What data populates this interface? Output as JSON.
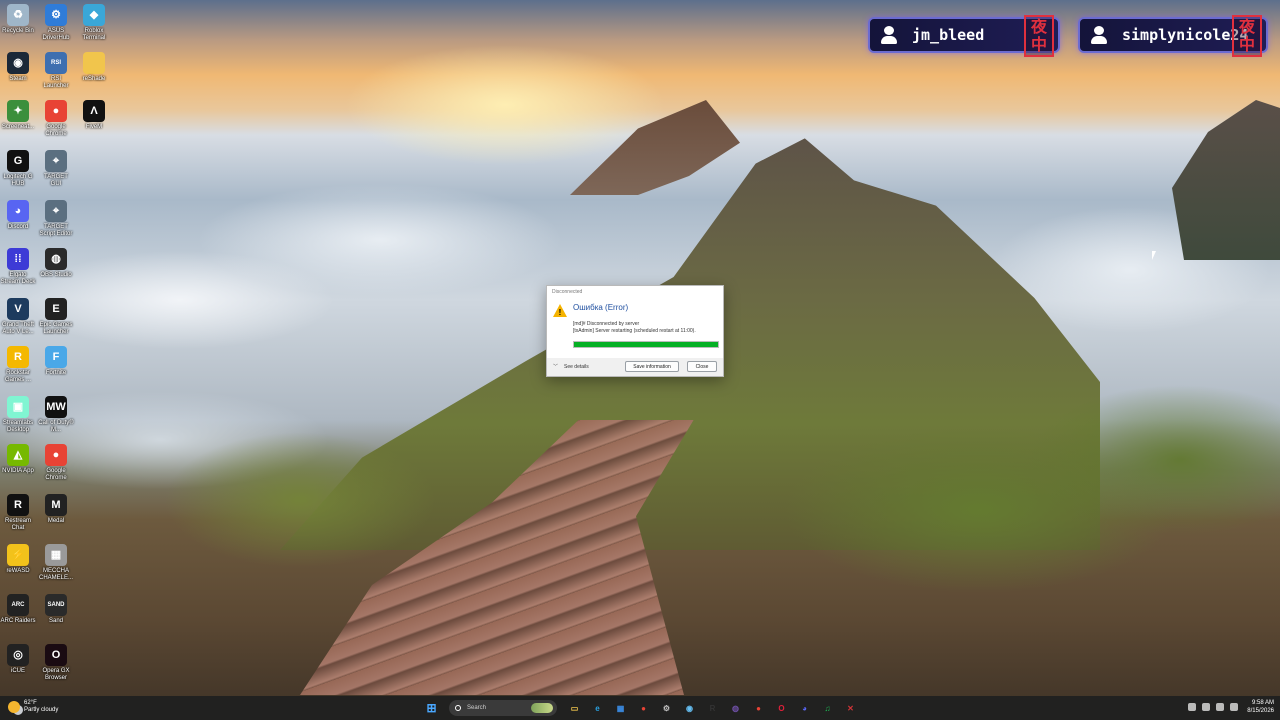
{
  "desktop_icons": [
    {
      "label": "Recycle Bin",
      "icon": "recycle-bin-icon",
      "color": "#9fb6c9",
      "glyph": "♻"
    },
    {
      "label": "ASUS DriverHub",
      "icon": "asus-icon",
      "color": "#2f7cd8",
      "glyph": "⚙"
    },
    {
      "label": "Roblox Terminal",
      "icon": "roblox-icon",
      "color": "#3aa7d8",
      "glyph": "◆"
    },
    {
      "label": "Steam",
      "icon": "steam-icon",
      "color": "#1b2838",
      "glyph": "◉"
    },
    {
      "label": "RSI Launcher",
      "icon": "rsi-icon",
      "color": "#3e6fb0",
      "glyph": "RSI"
    },
    {
      "label": "reShade",
      "icon": "folder-icon",
      "color": "#f1c54c",
      "glyph": ""
    },
    {
      "label": "Screeneat...",
      "icon": "app-icon",
      "color": "#3c8f3c",
      "glyph": "✦"
    },
    {
      "label": "Google Chrome",
      "icon": "chrome-icon",
      "color": "#e84335",
      "glyph": "●"
    },
    {
      "label": "FiveM",
      "icon": "fivem-icon",
      "color": "#111111",
      "glyph": "Λ"
    },
    {
      "label": "Logitech G HUB",
      "icon": "logitech-icon",
      "color": "#111111",
      "glyph": "G"
    },
    {
      "label": "TARGET GUI",
      "icon": "target-icon",
      "color": "#5b6f80",
      "glyph": "⌖"
    },
    {
      "label": "Discord",
      "icon": "discord-icon",
      "color": "#5865f2",
      "glyph": "◕"
    },
    {
      "label": "TARGET Script Editor",
      "icon": "target-script-icon",
      "color": "#5b6f80",
      "glyph": "⌖"
    },
    {
      "label": "Elgato Stream Deck",
      "icon": "streamdeck-icon",
      "color": "#3d3bd6",
      "glyph": "⁞⁞"
    },
    {
      "label": "OBS Studio",
      "icon": "obs-icon",
      "color": "#2b2b2b",
      "glyph": "◍"
    },
    {
      "label": "Grand Theft Auto V Le...",
      "icon": "gta-icon",
      "color": "#1d3b5e",
      "glyph": "V"
    },
    {
      "label": "Epic Games Launcher",
      "icon": "epic-icon",
      "color": "#222222",
      "glyph": "E"
    },
    {
      "label": "Rockstar Games ...",
      "icon": "rockstar-icon",
      "color": "#f4b800",
      "glyph": "R"
    },
    {
      "label": "Fortnite",
      "icon": "fortnite-icon",
      "color": "#4aa8e8",
      "glyph": "F"
    },
    {
      "label": "Streamlabs Desktop",
      "icon": "streamlabs-icon",
      "color": "#80f5d2",
      "glyph": "▣"
    },
    {
      "label": "Call of Duty® M...",
      "icon": "cod-icon",
      "color": "#111111",
      "glyph": "MW"
    },
    {
      "label": "NVIDIA App",
      "icon": "nvidia-icon",
      "color": "#76b900",
      "glyph": "◭"
    },
    {
      "label": "Google Chrome",
      "icon": "chrome-icon",
      "color": "#e84335",
      "glyph": "●"
    },
    {
      "label": "Restream Chat",
      "icon": "restream-icon",
      "color": "#111111",
      "glyph": "R"
    },
    {
      "label": "Medal",
      "icon": "medal-icon",
      "color": "#222222",
      "glyph": "M"
    },
    {
      "label": "reWASD",
      "icon": "rewasd-icon",
      "color": "#f2c21b",
      "glyph": "⚡"
    },
    {
      "label": "MECCHA CHAMELE...",
      "icon": "meccha-icon",
      "color": "#9a9a9a",
      "glyph": "▦"
    },
    {
      "label": "ARC Raiders",
      "icon": "arc-raiders-icon",
      "color": "#222222",
      "glyph": "ARC"
    },
    {
      "label": "Sand",
      "icon": "sand-icon",
      "color": "#2a2a2a",
      "glyph": "SAND"
    },
    {
      "label": "iCUE",
      "icon": "icue-icon",
      "color": "#222222",
      "glyph": "◎"
    },
    {
      "label": "Opera GX Browser",
      "icon": "opera-gx-icon",
      "color": "#1a0b12",
      "glyph": "O"
    }
  ],
  "badges": [
    {
      "name": "jm_bleed",
      "seal": "夜中"
    },
    {
      "name": "simplynicole24",
      "seal": "夜中"
    }
  ],
  "dialog": {
    "window_title": "Disconnected",
    "heading": "Ошибка (Error)",
    "message_line1": "[md]# Disconnected by server",
    "message_line2": "[txAdmin] Server restarting (scheduled restart at 11:00).",
    "progress_fraction": 1.0,
    "see_details": "See details",
    "save_button": "Save information",
    "close_button": "Close",
    "accent": "#06b025"
  },
  "taskbar": {
    "weather_temp": "62°F",
    "weather_desc": "Partly cloudy",
    "search_placeholder": "Search",
    "pinned": [
      {
        "icon": "file-explorer-icon",
        "color": "#f1c54c",
        "glyph": "▭"
      },
      {
        "icon": "edge-icon",
        "color": "#2aa1e0",
        "glyph": "e"
      },
      {
        "icon": "store-icon",
        "color": "#3b8ee8",
        "glyph": "▦"
      },
      {
        "icon": "chrome-icon",
        "color": "#e84335",
        "glyph": "●"
      },
      {
        "icon": "settings-icon",
        "color": "#bfbfbf",
        "glyph": "⚙"
      },
      {
        "icon": "steam-icon",
        "color": "#66c0f4",
        "glyph": "◉"
      },
      {
        "icon": "rockstar-icon",
        "color": "#333333",
        "glyph": "R"
      },
      {
        "icon": "obs-icon",
        "color": "#6d4fa3",
        "glyph": "◍"
      },
      {
        "icon": "chrome-icon",
        "color": "#e84335",
        "glyph": "●"
      },
      {
        "icon": "opera-gx-icon",
        "color": "#e0203a",
        "glyph": "O"
      },
      {
        "icon": "discord-icon",
        "color": "#5865f2",
        "glyph": "◕"
      },
      {
        "icon": "spotify-icon",
        "color": "#1db954",
        "glyph": "♫"
      },
      {
        "icon": "fivem-icon",
        "color": "#d13438",
        "glyph": "✕"
      }
    ],
    "time": "9:58 AM",
    "date": "8/15/2026"
  }
}
